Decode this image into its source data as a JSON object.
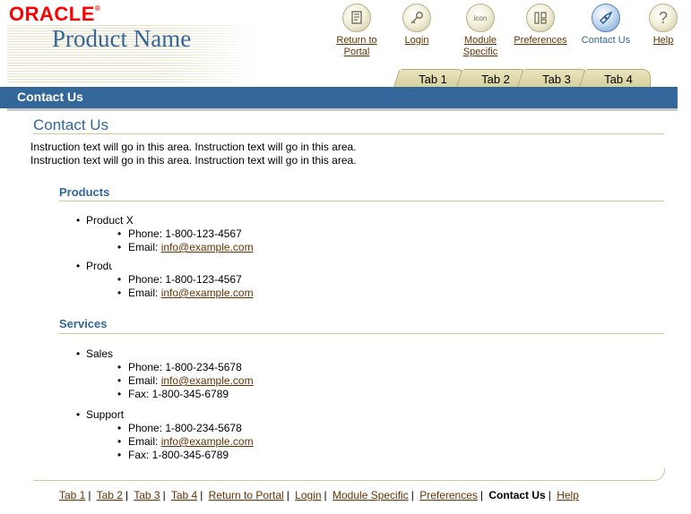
{
  "branding": {
    "company": "ORACLE",
    "product_name": "Product Name"
  },
  "global_buttons": [
    {
      "label": "Return to Portal",
      "icon": "portal-icon"
    },
    {
      "label": "Login",
      "icon": "key-icon"
    },
    {
      "label": "Module Specific",
      "icon": "icon-placeholder",
      "icon_text": "icon"
    },
    {
      "label": "Preferences",
      "icon": "preferences-icon"
    },
    {
      "label": "Contact Us",
      "icon": "contact-us-icon"
    },
    {
      "label": "Help",
      "icon": "help-icon"
    }
  ],
  "tabs": [
    "Tab 1",
    "Tab 2",
    "Tab 3",
    "Tab 4"
  ],
  "title_bar": "Contact Us",
  "page": {
    "heading": "Contact Us",
    "instructions": [
      "Instruction text will go in this area. Instruction text will go in this area.",
      "Instruction text will go in this area. Instruction text will go in this area."
    ]
  },
  "products": {
    "heading": "Products",
    "items": [
      {
        "name": "Product X",
        "details": {
          "phone": "Phone: 1-800-123-4567",
          "email_label": "Email: ",
          "email": "info@example.com"
        }
      },
      {
        "name": "Produ",
        "details": {
          "phone": "Phone: 1-800-123-4567",
          "email_label": "Email: ",
          "email": "info@example.com"
        }
      }
    ]
  },
  "services": {
    "heading": "Services",
    "items": [
      {
        "name": "Sales",
        "details": {
          "phone": "Phone: 1-800-234-5678",
          "email_label": "Email: ",
          "email": "info@example.com",
          "fax": "Fax: 1-800-345-6789"
        }
      },
      {
        "name": "Support",
        "details": {
          "phone": "Phone: 1-800-234-5678",
          "email_label": "Email: ",
          "email": "info@example.com",
          "fax": "Fax: 1-800-345-6789"
        }
      }
    ]
  },
  "footer": {
    "links": [
      "Tab 1",
      "Tab 2",
      "Tab 3",
      "Tab 4",
      "Return to Portal",
      "Login",
      "Module Specific",
      "Preferences"
    ],
    "current": "Contact Us",
    "help": "Help",
    "separator": "|"
  },
  "colors": {
    "title_bar": "#336699",
    "link": "#663300",
    "heading": "#336699",
    "logo": "#ff0000",
    "tab": "#d6cf9c"
  }
}
